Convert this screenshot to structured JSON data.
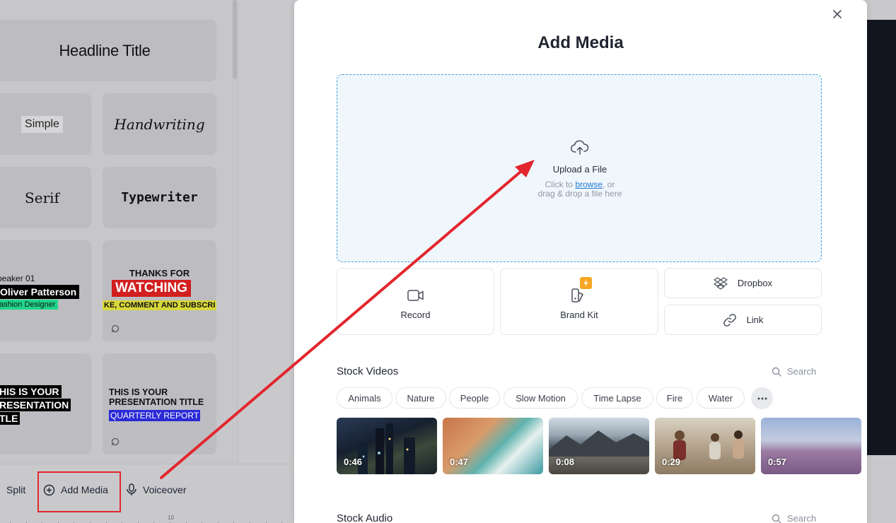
{
  "left_panel": {
    "headline": "Headline Title",
    "simple": "Simple",
    "handwriting": "Handwriting",
    "serif": "Serif",
    "typewriter": "Typewriter",
    "speaker": {
      "line1": "peaker 01",
      "line2": "Oliver Patterson",
      "line3": "ashion Designer"
    },
    "thanks": {
      "line1": "THANKS FOR",
      "line2": "WATCHING",
      "line3": "KE, COMMENT AND SUBSCRI"
    },
    "thisis": {
      "line1": "HIS IS YOUR",
      "line2": "RESENTATION",
      "line3": "TLE"
    },
    "pres": {
      "line1": "THIS IS YOUR",
      "line2": "PRESENTATION TITLE",
      "line3": "QUARTERLY REPORT"
    }
  },
  "toolbar": {
    "split": "Split",
    "add_media": "Add Media",
    "voiceover": "Voiceover",
    "ruler_label": "10"
  },
  "modal": {
    "title": "Add Media",
    "upload": {
      "title": "Upload a File",
      "hint_prefix": "Click to ",
      "browse": "browse",
      "hint_suffix": ", or",
      "hint_line2": "drag & drop a file here"
    },
    "options": {
      "record": "Record",
      "brand_kit": "Brand Kit",
      "dropbox": "Dropbox",
      "link": "Link"
    },
    "stock_videos": {
      "title": "Stock Videos",
      "search": "Search",
      "chips": [
        "Animals",
        "Nature",
        "People",
        "Slow Motion",
        "Time Lapse",
        "Fire",
        "Water"
      ],
      "durations": [
        "0:46",
        "0:47",
        "0:08",
        "0:29",
        "0:57"
      ]
    },
    "stock_audio": {
      "title": "Stock Audio",
      "search": "Search"
    }
  },
  "colors": {
    "accent_red": "#e3262e",
    "upload_border": "#4a9fd3",
    "link_blue": "#2379d3",
    "brand_badge": "#f5a623"
  }
}
